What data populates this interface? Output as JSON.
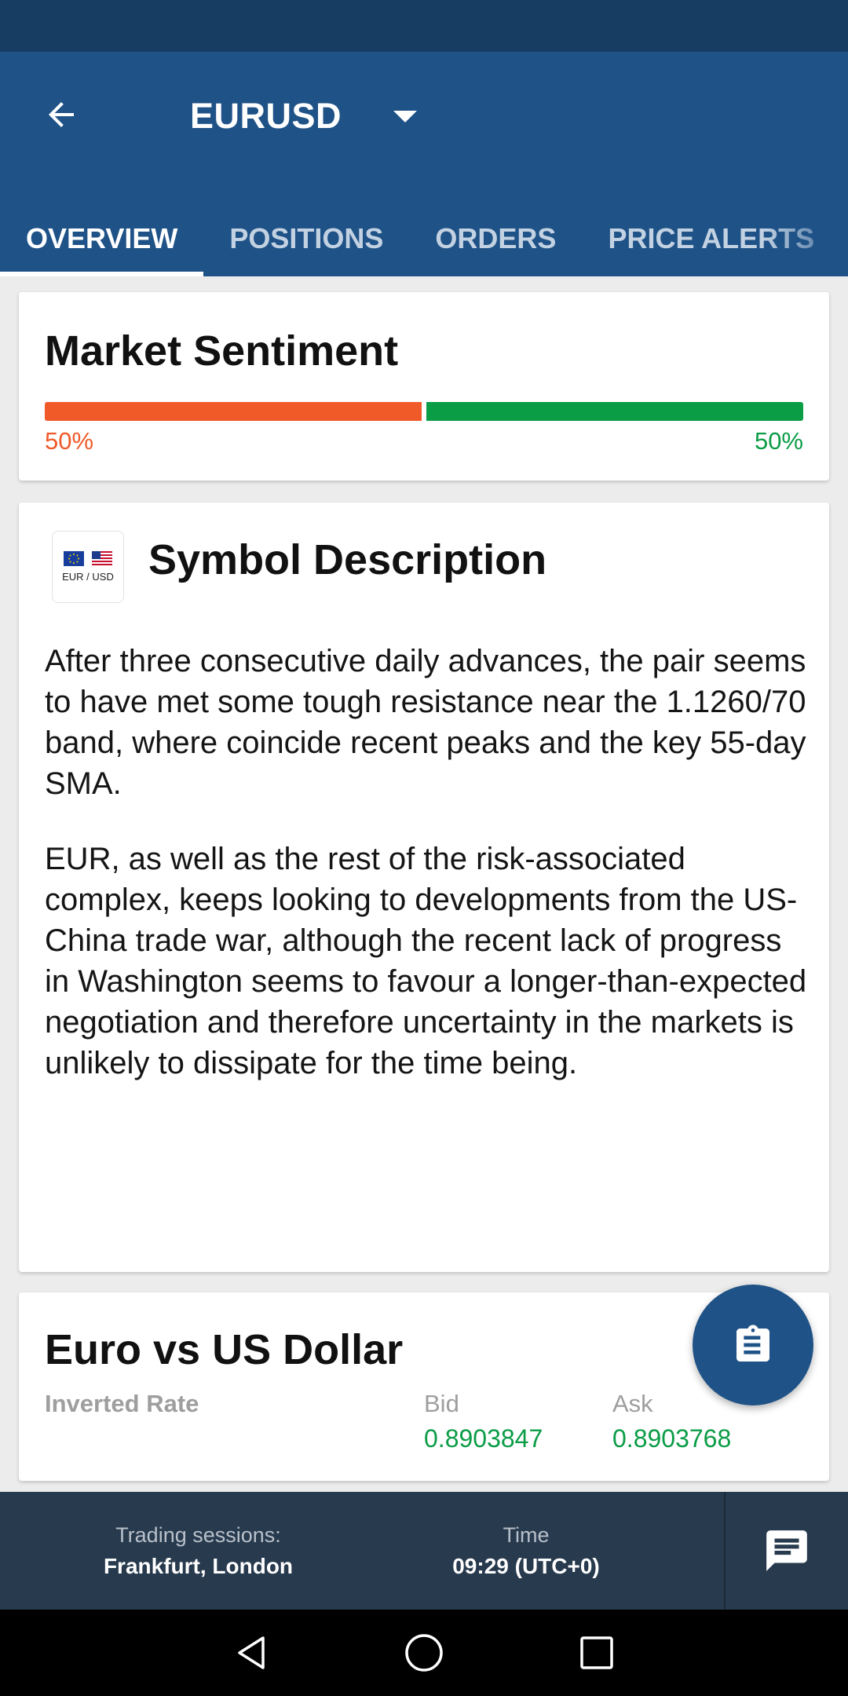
{
  "header": {
    "symbol": "EURUSD",
    "back_icon": "arrow-back-icon",
    "dropdown_icon": "caret-down-icon"
  },
  "tabs": [
    {
      "label": "OVERVIEW",
      "active": true
    },
    {
      "label": "POSITIONS",
      "active": false
    },
    {
      "label": "ORDERS",
      "active": false
    },
    {
      "label": "PRICE ALERTS",
      "active": false
    }
  ],
  "sentiment": {
    "title": "Market Sentiment",
    "sell_percent": 50,
    "buy_percent": 50,
    "sell_label": "50%",
    "buy_label": "50%",
    "sell_color": "#f05a28",
    "buy_color": "#0b9c46"
  },
  "description": {
    "title": "Symbol Description",
    "logo_text": "EUR / USD",
    "paragraphs": [
      "After three consecutive daily advances, the pair seems to have met some tough resistance near the 1.1260/70 band, where coincide recent peaks and the key 55-day SMA.",
      "EUR, as well as the rest of the risk-associated complex, keeps looking to developments from the US-China trade war, although the recent lack of progress in Washington seems to favour a longer-than-expected negotiation and therefore uncertainty in the markets is unlikely to dissipate for the time being."
    ]
  },
  "rate": {
    "title": "Euro vs US Dollar",
    "inverted_label": "Inverted Rate",
    "bid_label": "Bid",
    "ask_label": "Ask",
    "bid_value": "0.8903847",
    "ask_value": "0.8903768"
  },
  "fab": {
    "icon": "clipboard-icon"
  },
  "bottom": {
    "sessions_label": "Trading sessions:",
    "sessions_value": "Frankfurt, London",
    "time_label": "Time",
    "time_value": "09:29 (UTC+0)",
    "chat_icon": "chat-icon"
  },
  "colors": {
    "primary": "#1f5287",
    "status_bar": "#173d63",
    "bottom_bar": "#283a4e"
  }
}
